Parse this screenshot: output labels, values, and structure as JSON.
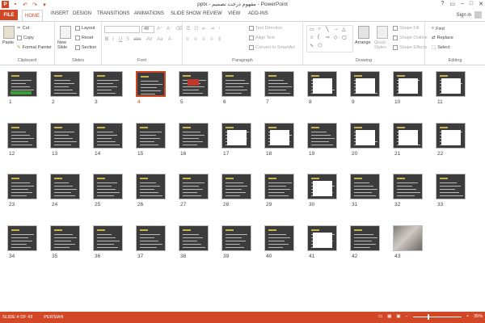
{
  "window": {
    "title": "pptx - مفهوم درخت تصمیم - PowerPoint",
    "help": "?",
    "controls": [
      "restore",
      "minimize",
      "maximize",
      "close"
    ]
  },
  "quick_access": {
    "app_logo": "P",
    "items": [
      "save-icon",
      "undo-icon",
      "redo-icon",
      "customize-icon"
    ]
  },
  "tabs": [
    {
      "label": "FILE"
    },
    {
      "label": "HOME",
      "active": true
    },
    {
      "label": "INSERT"
    },
    {
      "label": "DESIGN"
    },
    {
      "label": "TRANSITIONS"
    },
    {
      "label": "ANIMATIONS"
    },
    {
      "label": "SLIDE SHOW"
    },
    {
      "label": "REVIEW"
    },
    {
      "label": "VIEW"
    },
    {
      "label": "ADD-INS"
    }
  ],
  "signin": "Sign in",
  "ribbon": {
    "clipboard": {
      "paste": "Paste",
      "cut": "Cut",
      "copy": "Copy",
      "format_painter": "Format Painter",
      "label": "Clipboard"
    },
    "slides": {
      "new_slide": "New Slide",
      "layout": "Layout",
      "reset": "Reset",
      "section": "Section",
      "label": "Slides"
    },
    "font": {
      "size": "48",
      "label": "Font"
    },
    "paragraph": {
      "text_direction": "Text Direction",
      "align_text": "Align Text",
      "convert_smartart": "Convert to SmartArt",
      "label": "Paragraph"
    },
    "drawing": {
      "arrange": "Arrange",
      "quick_styles": "Quick Styles",
      "shape_fill": "Shape Fill",
      "shape_outline": "Shape Outline",
      "shape_effects": "Shape Effects",
      "label": "Drawing"
    },
    "editing": {
      "find": "Find",
      "replace": "Replace",
      "select": "Select",
      "label": "Editing"
    }
  },
  "slides": {
    "selected": 4,
    "numbers": [
      "1",
      "2",
      "3",
      "4",
      "5",
      "6",
      "7",
      "8",
      "9",
      "10",
      "11",
      "12",
      "13",
      "14",
      "15",
      "16",
      "17",
      "18",
      "19",
      "20",
      "21",
      "22",
      "23",
      "24",
      "25",
      "26",
      "27",
      "28",
      "29",
      "30",
      "31",
      "32",
      "33",
      "34",
      "35",
      "36",
      "37",
      "38",
      "39",
      "40",
      "41",
      "42",
      "43"
    ]
  },
  "status": {
    "slide_info": "SLIDE 4 OF 43",
    "language": "PERSIAN",
    "zoom": "35%"
  }
}
